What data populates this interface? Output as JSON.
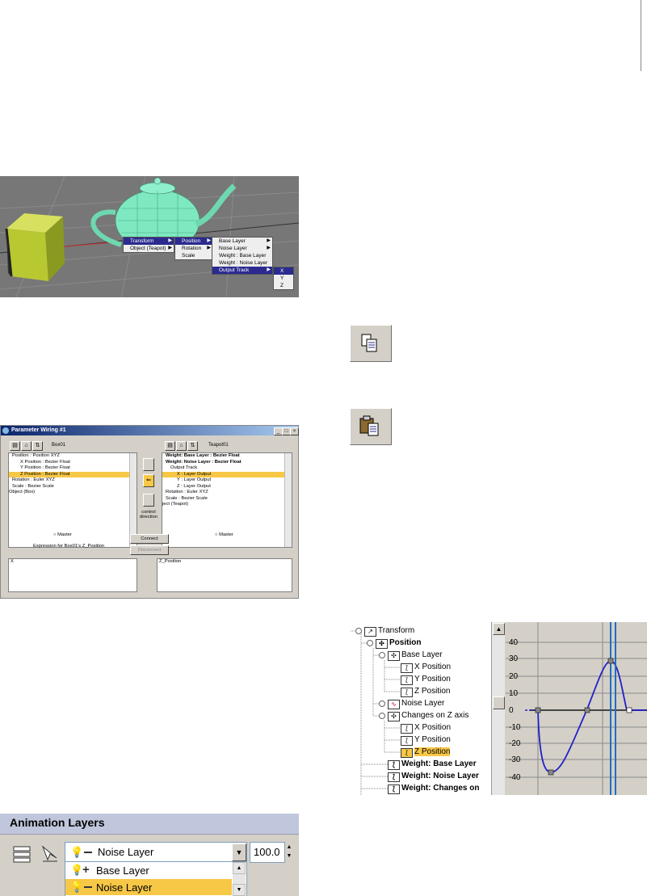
{
  "viewport": {
    "quad_menu": {
      "col1": [
        "Transform",
        "Object (Teapot)"
      ],
      "col2": [
        "Position",
        "Rotation",
        "Scale"
      ],
      "col3": [
        "Base Layer",
        "Noise Layer",
        "Weight : Base Layer",
        "Weight : Noise Layer",
        "Output Track"
      ],
      "col4": [
        "X",
        "Y",
        "Z"
      ]
    }
  },
  "param_wiring": {
    "title": "Parameter Wiring #1",
    "left_object": "Box01",
    "right_object": "Teapot01",
    "left_tree": [
      "Position : Position XYZ",
      "X Position : Bezier Float",
      "Y Position : Bezier Float",
      "Z Position : Bezier Float",
      "Rotation : Euler XYZ",
      "Scale : Bezier Scale",
      "Object (Box)"
    ],
    "right_tree": [
      "Weight: Base Layer : Bezier Float",
      "Weight: Noise Layer : Bezier Float",
      "Output Track",
      "X : Layer Output",
      "Y : Layer Output",
      "Z : Layer Output",
      "Rotation : Euler XYZ",
      "Scale : Bezier Scale",
      "ject (Teapot)"
    ],
    "control_direction": "control direction",
    "master_left": "Master",
    "master_right": "Master",
    "connect": "Connect",
    "disconnect": "Disconnect",
    "expression_label": "Expression for Box01's Z_Position",
    "left_expr": "X",
    "right_expr": "Z_Position"
  },
  "curve_editor": {
    "tree": [
      {
        "label": "Transform",
        "bold": false
      },
      {
        "label": "Position",
        "bold": true
      },
      {
        "label": "Base Layer",
        "bold": false
      },
      {
        "label": "X Position",
        "bold": false
      },
      {
        "label": "Y Position",
        "bold": false
      },
      {
        "label": "Z Position",
        "bold": false
      },
      {
        "label": "Noise Layer",
        "bold": false
      },
      {
        "label": "Changes on Z axis",
        "bold": false
      },
      {
        "label": "X Position",
        "bold": false
      },
      {
        "label": "Y Position",
        "bold": false
      },
      {
        "label": "Z Position",
        "bold": false,
        "selected": true
      },
      {
        "label": "Weight: Base Layer",
        "bold": true
      },
      {
        "label": "Weight: Noise Layer",
        "bold": true
      },
      {
        "label": "Weight: Changes on",
        "bold": true
      }
    ],
    "y_ticks": [
      "40",
      "30",
      "20",
      "10",
      "0",
      "-10",
      "-20",
      "-30",
      "-40"
    ]
  },
  "anim_layers": {
    "title": "Animation Layers",
    "current_layer": "Noise Layer",
    "weight": "100.0",
    "list": [
      "Base Layer",
      "Noise Layer"
    ]
  },
  "colors": {
    "highlight": "#f7c746",
    "title_blue": "#0a246a",
    "curve": "#2020c8",
    "time_slider": "#1f6fc0",
    "teapot": "#7ee8c0",
    "box": "#b8c830"
  }
}
